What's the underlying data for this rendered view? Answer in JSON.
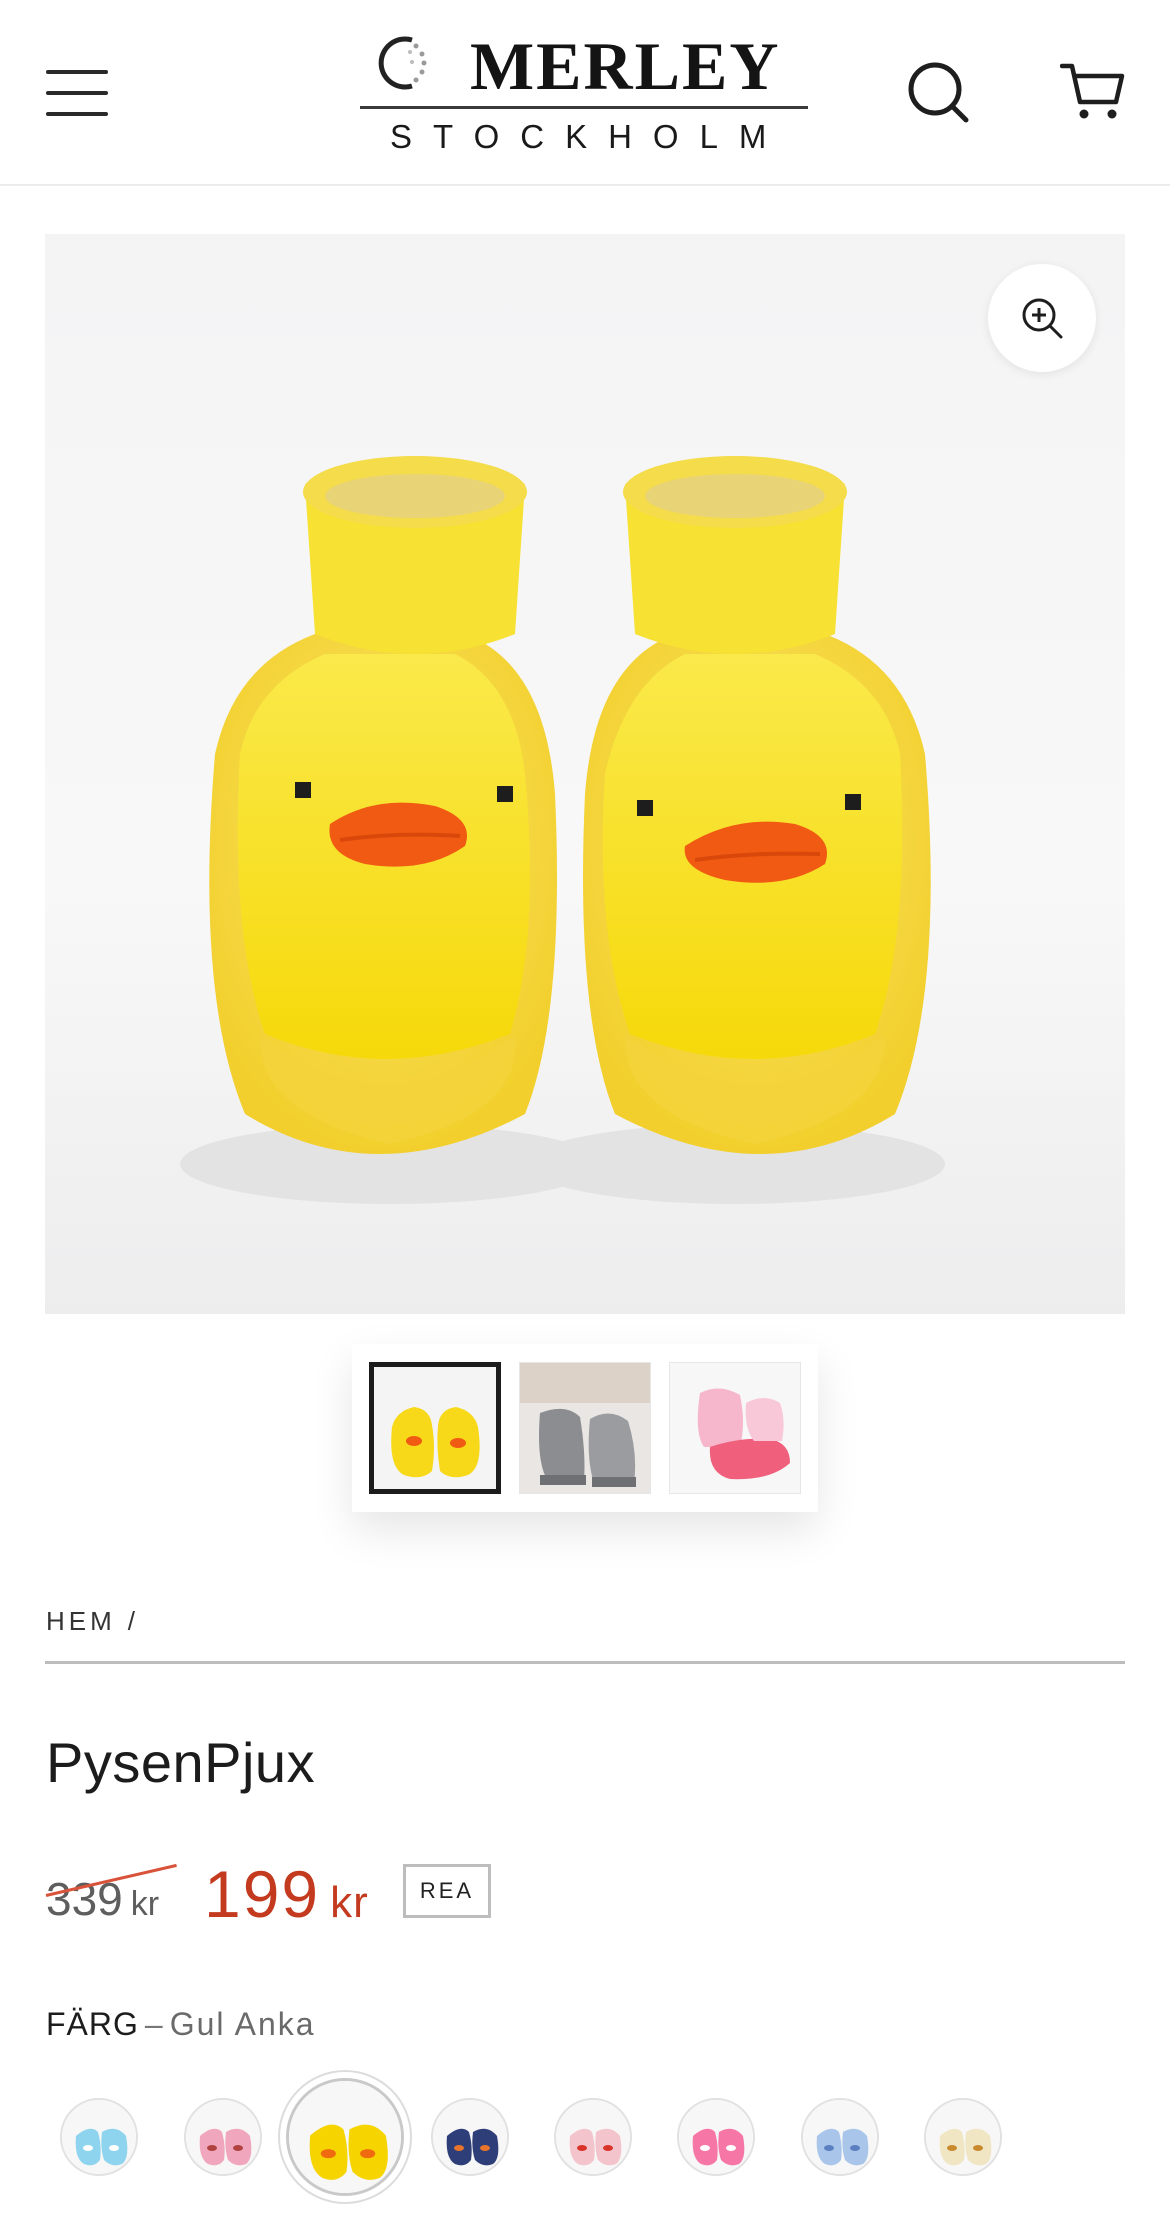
{
  "header": {
    "brand_name": "MERLEY",
    "brand_city": "STOCKHOLM",
    "menu_icon": "hamburger-icon",
    "search_icon": "search-icon",
    "cart_icon": "cart-icon"
  },
  "gallery": {
    "main_image": "yellow-duck-sock-shoes",
    "zoom_icon": "zoom-in-icon",
    "thumbnails": [
      {
        "image": "yellow-duck-sock-shoes",
        "active": true
      },
      {
        "image": "grey-sock-shoes-worn",
        "active": false
      },
      {
        "image": "pink-sock-shoes",
        "active": false
      }
    ]
  },
  "breadcrumb": {
    "home_label": "HEM",
    "separator": "/"
  },
  "product": {
    "title": "PysenPjux",
    "old_price": "339",
    "old_currency": "kr",
    "price": "199",
    "currency": "kr",
    "sale_badge": "REA"
  },
  "color": {
    "label": "FÄRG",
    "dash": "–",
    "selected_value": "Gul Anka",
    "swatches": [
      {
        "name": "Ljusblå",
        "main": "#8fd4ee",
        "accent": "#ffffff"
      },
      {
        "name": "Rosa",
        "main": "#f0a6bd",
        "accent": "#b0423f"
      },
      {
        "name": "Gul Anka",
        "main": "#f5d400",
        "accent": "#f06a10"
      },
      {
        "name": "Marin",
        "main": "#2e3e78",
        "accent": "#e8742b"
      },
      {
        "name": "Rosa Röd",
        "main": "#f3c4cc",
        "accent": "#d9342a"
      },
      {
        "name": "Pink",
        "main": "#f676a6",
        "accent": "#ffffff"
      },
      {
        "name": "Blå",
        "main": "#a9c6ea",
        "accent": "#5b7fc0"
      },
      {
        "name": "Beige",
        "main": "#f0e6c4",
        "accent": "#c98a2e"
      }
    ]
  },
  "colors": {
    "sale_red": "#c33a1f",
    "text": "#1c1c1c",
    "duck_yellow": "#f5d400",
    "beak_orange": "#f05a12"
  }
}
